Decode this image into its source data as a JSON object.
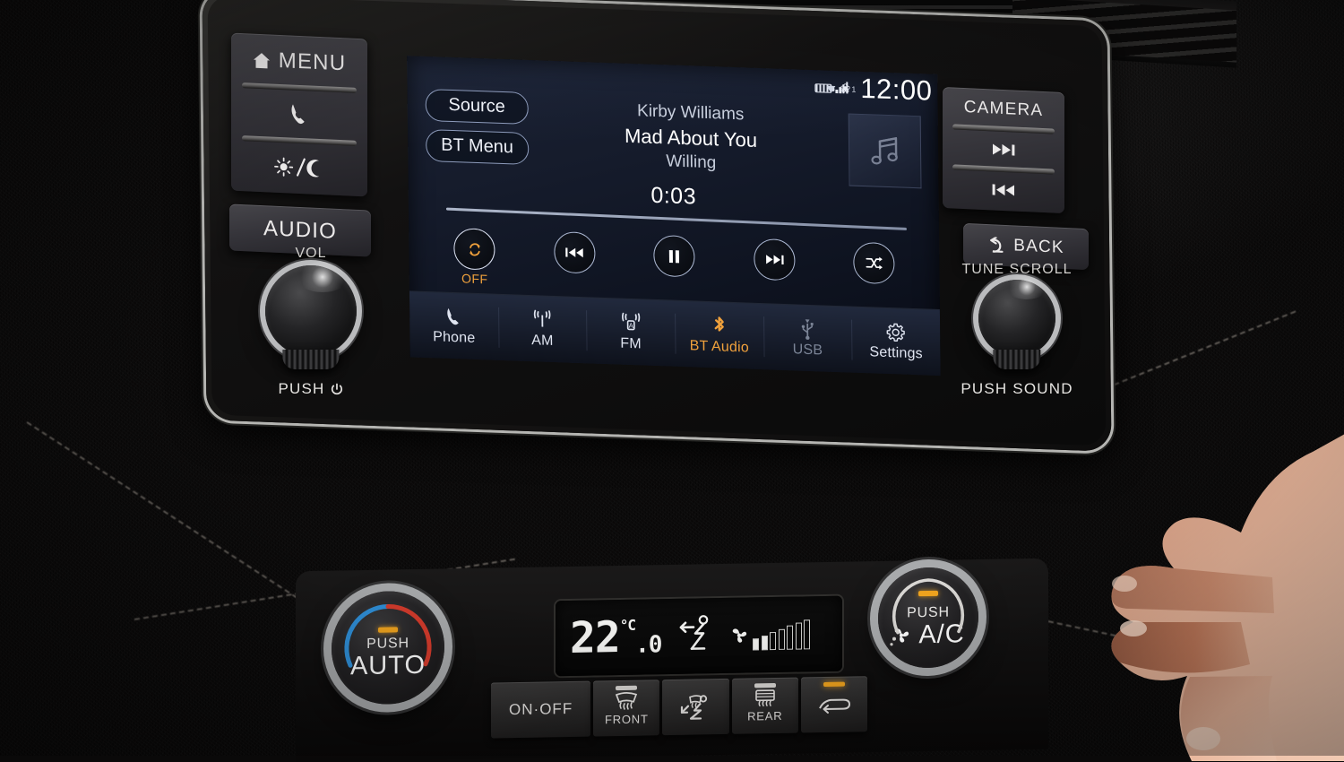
{
  "status_bar": {
    "clock": "12:00",
    "bluetooth_count": "1",
    "battery_icon": "battery-icon",
    "signal_icon": "signal-bars-icon",
    "bluetooth_icon": "bluetooth-icon"
  },
  "screen": {
    "pills": [
      {
        "label": "Source",
        "name": "source-button"
      },
      {
        "label": "BT Menu",
        "name": "bt-menu-button"
      }
    ],
    "now_playing": {
      "artist": "Kirby Williams",
      "title": "Mad About You",
      "album": "Willing",
      "elapsed": "0:03",
      "album_art_icon": "music-note-icon"
    },
    "transport": [
      {
        "name": "repeat-button",
        "icon": "repeat-icon",
        "label": "OFF",
        "accent": true
      },
      {
        "name": "previous-track-button",
        "icon": "previous-icon",
        "label": ""
      },
      {
        "name": "pause-button",
        "icon": "pause-icon",
        "label": ""
      },
      {
        "name": "next-track-button",
        "icon": "next-icon",
        "label": ""
      },
      {
        "name": "shuffle-button",
        "icon": "shuffle-icon",
        "label": ""
      }
    ],
    "tabs": [
      {
        "label": "Phone",
        "icon": "phone-icon",
        "state": "normal"
      },
      {
        "label": "AM",
        "icon": "am-radio-icon",
        "state": "normal"
      },
      {
        "label": "FM",
        "icon": "fm-radio-icon",
        "state": "normal"
      },
      {
        "label": "BT Audio",
        "icon": "bluetooth-icon",
        "state": "active"
      },
      {
        "label": "USB",
        "icon": "usb-icon",
        "state": "dim"
      },
      {
        "label": "Settings",
        "icon": "gear-icon",
        "state": "normal"
      }
    ]
  },
  "hardware": {
    "left_buttons": [
      {
        "label": "MENU",
        "icon": "home-icon",
        "name": "menu-button"
      },
      {
        "label": "",
        "icon": "phone-icon",
        "name": "phone-hard-button"
      },
      {
        "label": "",
        "icon": "day-night-icon",
        "name": "day-night-button"
      }
    ],
    "audio_button": {
      "label": "AUDIO",
      "name": "audio-button"
    },
    "right_buttons": [
      {
        "label": "CAMERA",
        "icon": "",
        "name": "camera-button"
      },
      {
        "label": "",
        "icon": "next-icon",
        "name": "seek-up-button"
      },
      {
        "label": "",
        "icon": "previous-icon",
        "name": "seek-down-button"
      }
    ],
    "back_button": {
      "label": "BACK",
      "icon": "back-arrow-icon",
      "name": "back-button"
    },
    "vol_knob": {
      "top_label": "VOL",
      "bottom_label": "PUSH",
      "power_icon": "power-icon"
    },
    "tune_knob": {
      "top_label": "TUNE SCROLL",
      "bottom_label": "PUSH  SOUND"
    }
  },
  "climate": {
    "display": {
      "temperature": "22",
      "decimal": ".0",
      "unit": "°C",
      "mode_icon": "airflow-face-icon",
      "fan_icon": "fan-icon",
      "fan_level": 2,
      "fan_max": 7
    },
    "buttons": [
      {
        "label": "ON·OFF",
        "sub": "",
        "icon": "",
        "led": "none",
        "name": "climate-onoff-button"
      },
      {
        "label": "",
        "sub": "FRONT",
        "icon": "defrost-front-icon",
        "led": "white",
        "name": "front-defrost-button"
      },
      {
        "label": "",
        "sub": "",
        "icon": "airflow-mode-icon",
        "led": "none",
        "name": "airflow-mode-button"
      },
      {
        "label": "",
        "sub": "REAR",
        "icon": "defrost-rear-icon",
        "led": "white",
        "name": "rear-defrost-button"
      },
      {
        "label": "",
        "sub": "",
        "icon": "recirculate-icon",
        "led": "amber",
        "name": "recirculate-button"
      }
    ],
    "temp_knob": {
      "push_label": "PUSH",
      "main_label": "AUTO"
    },
    "fan_knob": {
      "push_label": "PUSH",
      "main_label": "A/C",
      "icon": "fan-icon"
    }
  },
  "colors": {
    "accent_orange": "#f0a13c",
    "screen_bg": "#151b2b",
    "text_primary": "#ffffff",
    "pill_border": "#8d9bbb",
    "amber_led": "#f0a41e",
    "climate_cold": "#2f8fd8",
    "climate_hot": "#d33b2c"
  }
}
